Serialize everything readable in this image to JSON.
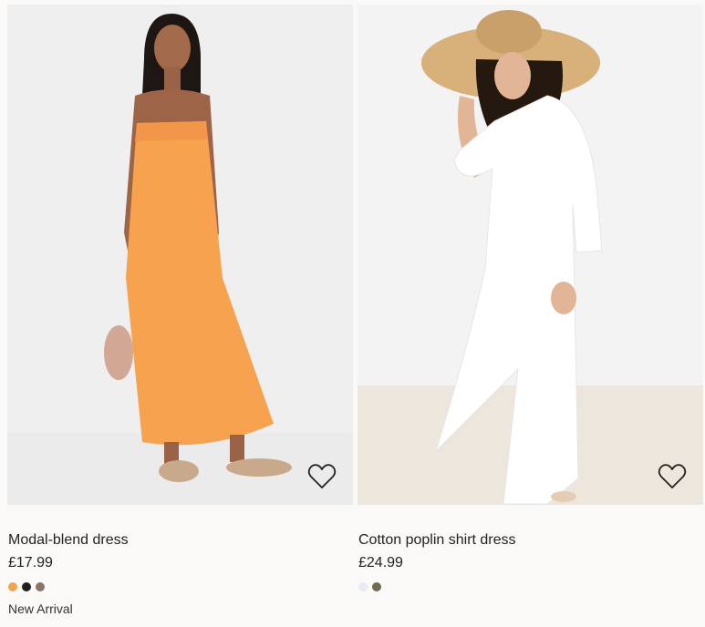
{
  "products": [
    {
      "name": "Modal-blend dress",
      "price": "£17.99",
      "badge": "New Arrival",
      "swatch_colors": [
        "#f0a44e",
        "#1f1f1f",
        "#8a7466"
      ],
      "image_desc_icon": "orange-dress-photo"
    },
    {
      "name": "Cotton poplin shirt dress",
      "price": "£24.99",
      "swatch_colors": [
        "#e7ecf7",
        "#6b6b4e"
      ],
      "image_desc_icon": "white-shirt-dress-photo"
    }
  ],
  "favorite_icon": "heart-outline-icon"
}
